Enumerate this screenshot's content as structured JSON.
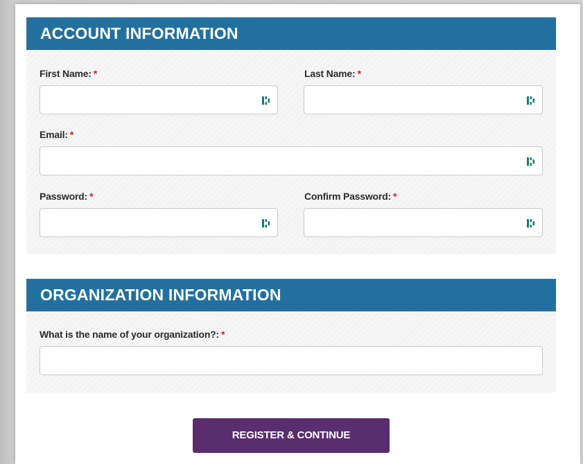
{
  "account": {
    "title": "ACCOUNT INFORMATION",
    "first_name_label": "First Name:",
    "last_name_label": "Last Name:",
    "email_label": "Email:",
    "password_label": "Password:",
    "confirm_password_label": "Confirm Password:",
    "required_mark": "*"
  },
  "organization": {
    "title": "ORGANIZATION INFORMATION",
    "org_name_label": "What is the name of your organization?:",
    "required_mark": "*"
  },
  "actions": {
    "register_label": "REGISTER & CONTINUE"
  },
  "colors": {
    "header_bg": "#23709e",
    "button_bg": "#5a2d6e",
    "required": "#d81e1e",
    "password_manager_icon": "#1a7a6e"
  },
  "icons": {
    "field_icon": "password-manager-icon"
  }
}
